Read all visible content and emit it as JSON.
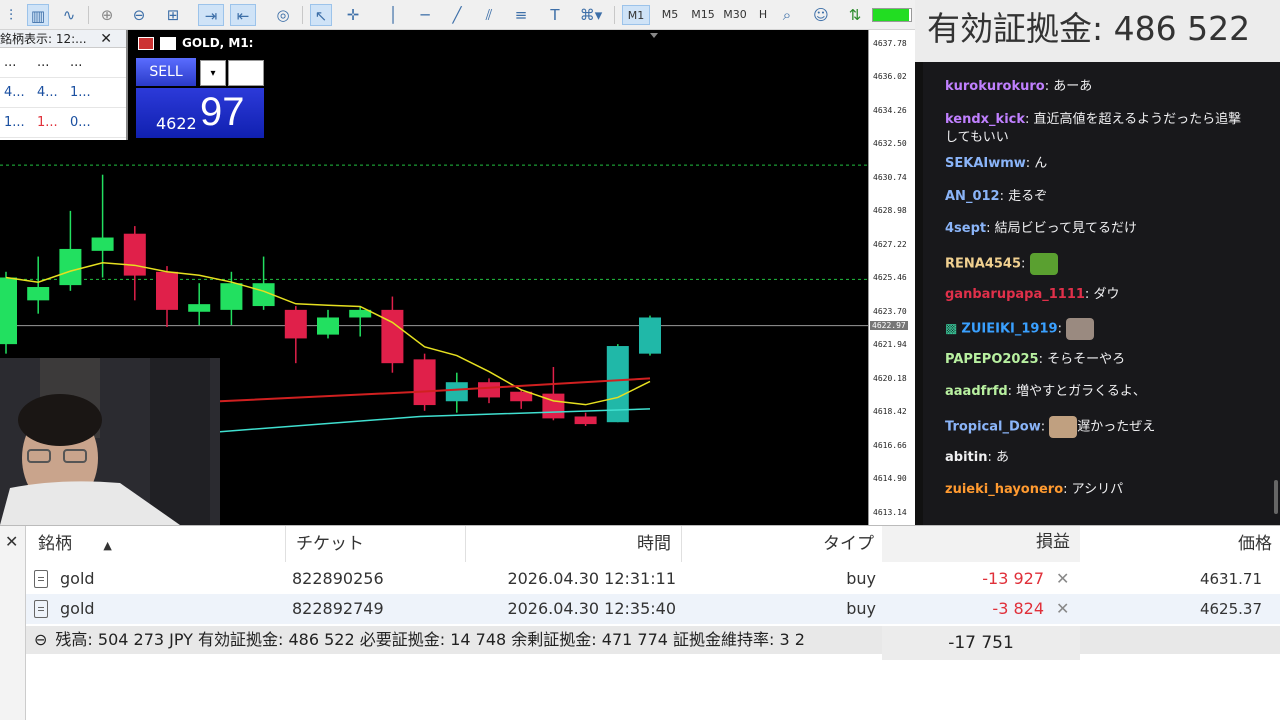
{
  "toolbar": {
    "timeframes": [
      "M1",
      "M5",
      "M15",
      "M30",
      "H"
    ],
    "active_timeframe": "M1",
    "connection_level": 0.95
  },
  "market_watch": {
    "title": "銘柄表示: 12:...",
    "rows": [
      [
        "...",
        "...",
        "..."
      ],
      [
        "4...",
        "4...",
        "1..."
      ],
      [
        "1...",
        "1...",
        "0..."
      ]
    ]
  },
  "one_click": {
    "symbol": "GOLD, M1:",
    "sell_label": "SELL",
    "dropdown_glyph": "▾",
    "bid_prefix": "4622",
    "bid_big": "97"
  },
  "price_scale": {
    "labels": [
      "4637.78",
      "4636.02",
      "4634.26",
      "4632.50",
      "4630.74",
      "4628.98",
      "4627.22",
      "4625.46",
      "4623.70",
      "4621.94",
      "4620.18",
      "4618.42",
      "4616.66",
      "4614.90",
      "4613.14"
    ],
    "current": "4622.97"
  },
  "chart_data": {
    "type": "candlestick",
    "symbol": "GOLD",
    "timeframe": "M1",
    "ylim": [
      4612.5,
      4638.5
    ],
    "candles": [
      {
        "o": 4622.0,
        "h": 4625.8,
        "l": 4621.5,
        "c": 4625.5
      },
      {
        "o": 4624.3,
        "h": 4626.6,
        "l": 4623.6,
        "c": 4625.0
      },
      {
        "o": 4625.1,
        "h": 4629.0,
        "l": 4624.8,
        "c": 4627.0
      },
      {
        "o": 4626.9,
        "h": 4630.9,
        "l": 4625.5,
        "c": 4627.6
      },
      {
        "o": 4627.8,
        "h": 4628.2,
        "l": 4624.3,
        "c": 4625.6
      },
      {
        "o": 4625.8,
        "h": 4626.1,
        "l": 4622.9,
        "c": 4623.8
      },
      {
        "o": 4623.7,
        "h": 4625.2,
        "l": 4623.0,
        "c": 4624.1
      },
      {
        "o": 4623.8,
        "h": 4625.8,
        "l": 4623.0,
        "c": 4625.2
      },
      {
        "o": 4624.0,
        "h": 4626.6,
        "l": 4623.8,
        "c": 4625.2
      },
      {
        "o": 4623.8,
        "h": 4624.0,
        "l": 4621.0,
        "c": 4622.3
      },
      {
        "o": 4622.5,
        "h": 4623.8,
        "l": 4622.3,
        "c": 4623.4
      },
      {
        "o": 4623.4,
        "h": 4624.0,
        "l": 4622.4,
        "c": 4623.8
      },
      {
        "o": 4623.8,
        "h": 4624.5,
        "l": 4620.5,
        "c": 4621.0
      },
      {
        "o": 4621.2,
        "h": 4621.5,
        "l": 4618.5,
        "c": 4618.8
      },
      {
        "o": 4619.0,
        "h": 4620.5,
        "l": 4618.4,
        "c": 4620.0
      },
      {
        "o": 4620.0,
        "h": 4620.2,
        "l": 4618.9,
        "c": 4619.2
      },
      {
        "o": 4619.5,
        "h": 4619.6,
        "l": 4618.6,
        "c": 4619.0
      },
      {
        "o": 4619.4,
        "h": 4620.8,
        "l": 4618.0,
        "c": 4618.1
      },
      {
        "o": 4618.2,
        "h": 4618.4,
        "l": 4617.7,
        "c": 4617.8
      },
      {
        "o": 4617.9,
        "h": 4622.0,
        "l": 4617.9,
        "c": 4621.9
      },
      {
        "o": 4621.5,
        "h": 4623.5,
        "l": 4621.4,
        "c": 4623.4
      }
    ],
    "levels": [
      4631.4,
      4625.4,
      4622.97
    ],
    "series_colors": {
      "up": "#22e060",
      "down": "#e0204a",
      "ma_fast": "#e6e020",
      "ma_red": "#d02020",
      "ma_teal": "#40e0d0"
    }
  },
  "stream": {
    "header": "有効証拠金: 486 522"
  },
  "chat": [
    {
      "user": "kurokurokuro",
      "color": "#c080ff",
      "text": "あーあ"
    },
    {
      "user": "kendx_kick",
      "color": "#c080ff",
      "text": "直近高値を超えるようだったら追撃",
      "text2": "してもいい"
    },
    {
      "user": "SEKAIwmw",
      "color": "#8ab4f8",
      "text": "ん"
    },
    {
      "user": "AN_012",
      "color": "#8ab4f8",
      "text": "走るぞ"
    },
    {
      "user": "4sept",
      "color": "#8ab4f8",
      "text": "結局ビビって見てるだけ"
    },
    {
      "user": "RENA4545",
      "color": "#f0d090",
      "text": "",
      "emote": "frog-emote"
    },
    {
      "user": "ganbarupapa_1111",
      "color": "#e0304a",
      "text": "ダウ"
    },
    {
      "user": "ZUIEIKI_1919",
      "color": "#3aa0ff",
      "text": "",
      "emote": "cat-emote",
      "gift": true
    },
    {
      "user": "PAPEPO2025",
      "color": "#b8f0a0",
      "text": "そらそーやろ"
    },
    {
      "user": "aaadfrfd",
      "color": "#b8f0a0",
      "text": "増やすとガラくるよ、"
    },
    {
      "user": "Tropical_Dow",
      "color": "#8ab4f8",
      "text": "遅かったぜえ",
      "emote": "face-emote",
      "emote_first": true
    },
    {
      "user": "abitin",
      "color": "#efeff1",
      "text": "あ"
    },
    {
      "user": "zuieki_hayonero",
      "color": "#ff9a30",
      "text": "アシリパ"
    }
  ],
  "terminal": {
    "headers": {
      "symbol": "銘柄",
      "ticket": "チケット",
      "time": "時間",
      "type": "タイプ",
      "profit": "損益",
      "price": "価格"
    },
    "sort_glyph": "▲",
    "close_glyph": "✕",
    "positions": [
      {
        "symbol": "gold",
        "ticket": "822890256",
        "time": "2026.04.30 12:31:11",
        "type": "buy",
        "profit": "-13 927",
        "price": "4631.71"
      },
      {
        "symbol": "gold",
        "ticket": "822892749",
        "time": "2026.04.30 12:35:40",
        "type": "buy",
        "profit": "-3 824",
        "price": "4625.37"
      }
    ],
    "summary": "残高: 504 273 JPY  有効証拠金: 486 522  必要証拠金: 14 748  余剰証拠金: 471 774  証拠金維持率: 3 2",
    "summary_glyph": "⊖",
    "total_profit": "-17 751"
  }
}
